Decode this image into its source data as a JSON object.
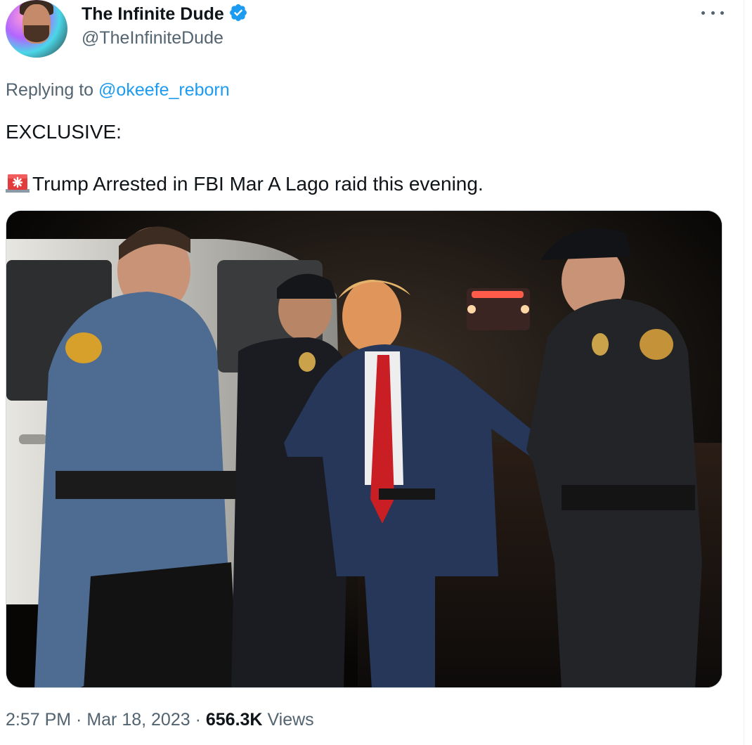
{
  "author": {
    "display_name": "The Infinite Dude",
    "handle": "@TheInfiniteDude",
    "verified_icon": "verified-badge-icon",
    "avatar_icon": "profile-avatar"
  },
  "more_icon": "more-options-icon",
  "reply": {
    "prefix": "Replying to ",
    "mention": "@okeefe_reborn"
  },
  "tweet": {
    "line1": "EXCLUSIVE:",
    "siren_icon": "rotating-light-emoji",
    "line2": "Trump Arrested in FBI Mar A Lago raid this evening."
  },
  "media": {
    "icon": "attached-photo"
  },
  "meta": {
    "time": "2:57 PM",
    "sep1": " · ",
    "date": "Mar 18, 2023",
    "sep2": " · ",
    "views_count": "656.3K",
    "views_label": " Views"
  },
  "colors": {
    "link": "#1d9bf0",
    "secondary_text": "#536471",
    "primary_text": "#0f1419"
  }
}
